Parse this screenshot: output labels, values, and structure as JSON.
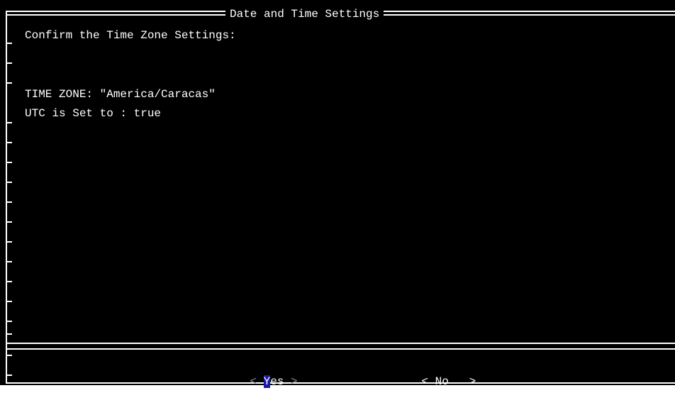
{
  "dialog": {
    "title": "Date and Time Settings",
    "prompt": "Confirm the Time Zone Settings:",
    "time_zone_line": "TIME ZONE: \"America/Caracas\"",
    "utc_line": "UTC is Set to : true"
  },
  "buttons": {
    "yes": {
      "open": "< ",
      "hotkey": "Y",
      "rest": "es",
      "close": " >"
    },
    "no": {
      "open": "< ",
      "hotkey": "N",
      "rest": "o  ",
      "close": " >"
    }
  },
  "colors": {
    "background": "#000000",
    "text": "#ffffff",
    "hotkey_highlight": "#1a1aa6"
  }
}
